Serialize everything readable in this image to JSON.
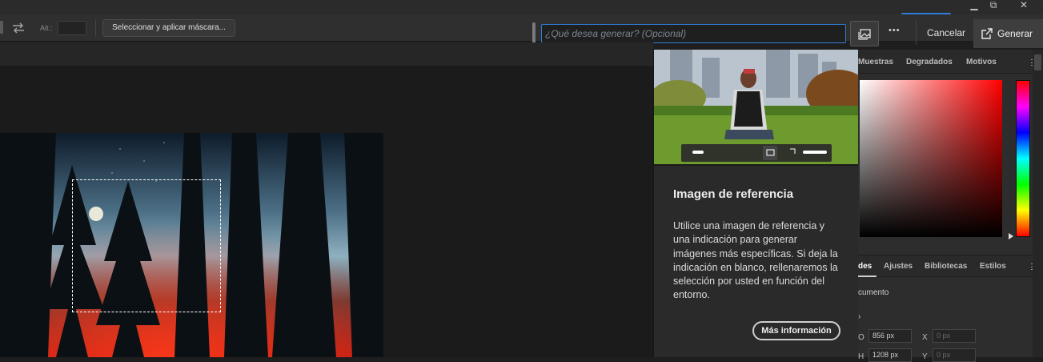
{
  "window": {
    "minimize": "▁",
    "restore": "⧉",
    "close": "✕"
  },
  "options_bar": {
    "swap_icon": "swap-arrows-icon",
    "height_label": "Alt.:",
    "height_value": "",
    "select_mask_button": "Seleccionar y aplicar máscara...",
    "prompt_placeholder": "¿Qué desea generar?  (Opcional)",
    "more_label": "•••",
    "cancel_label": "Cancelar",
    "generate_label": "Generar",
    "reference_image_icon": "reference-image-icon",
    "generate_icon": "generate-icon"
  },
  "popup": {
    "title": "Imagen de referencia",
    "body": "Utilice una imagen de referencia y una indicación para generar imágenes más específicas. Si deja la indicación en blanco, rellenaremos la selección por usted en función del entorno.",
    "more_info": "Más información"
  },
  "swatches_panel": {
    "tabs": [
      "Muestras",
      "Degradados",
      "Motivos"
    ]
  },
  "props_panel": {
    "tabs": [
      "des",
      "Ajustes",
      "Bibliotecas",
      "Estilos"
    ],
    "section": "cumento",
    "w_label": "O",
    "w_value": "856 px",
    "h_label": "H",
    "h_value": "1208 px",
    "x_label": "X",
    "x_placeholder": "0 px",
    "y_label": "Y",
    "y_placeholder": "0 px"
  },
  "colors": {
    "accent": "#2f7cd6",
    "bg": "#1e1e1e",
    "panel": "#2d2d2d"
  }
}
